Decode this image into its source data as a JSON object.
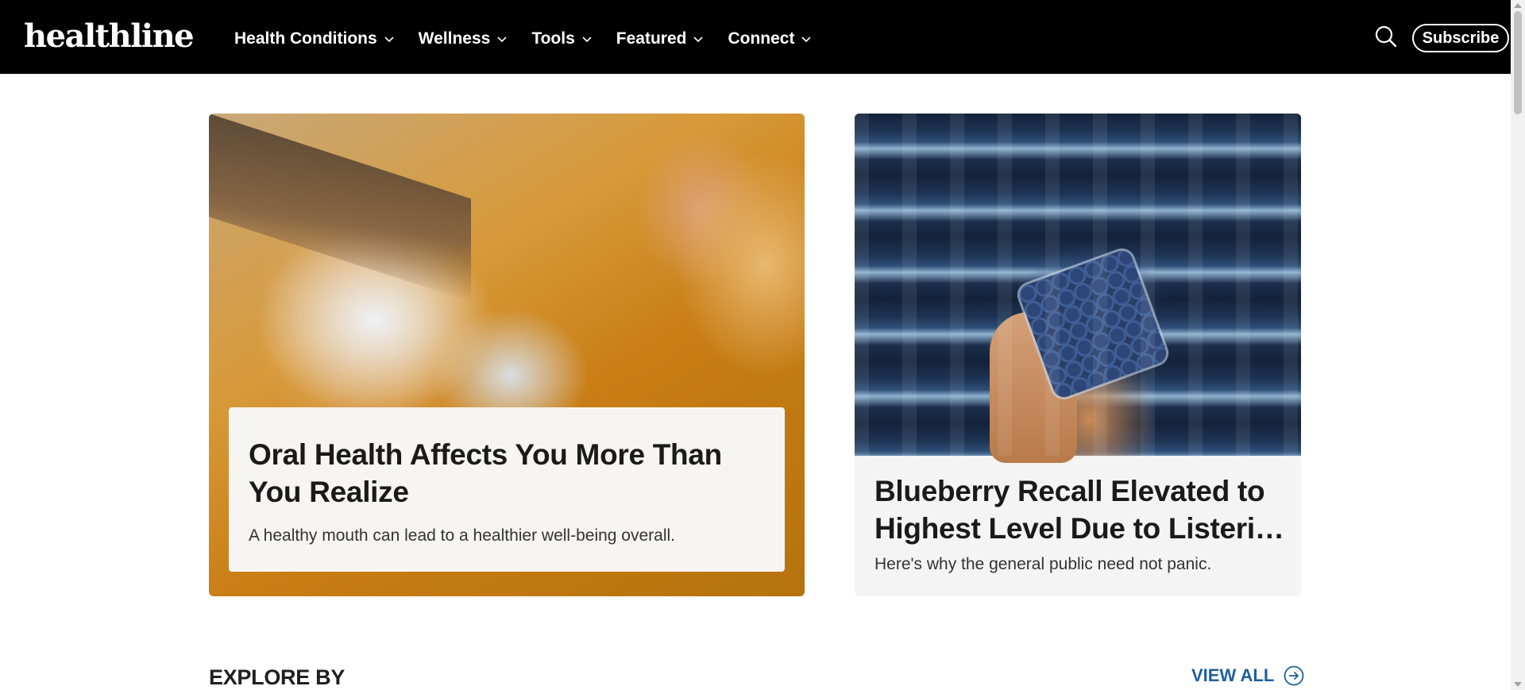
{
  "header": {
    "logo": "healthline",
    "nav": [
      {
        "label": "Health Conditions"
      },
      {
        "label": "Wellness"
      },
      {
        "label": "Tools"
      },
      {
        "label": "Featured"
      },
      {
        "label": "Connect"
      }
    ],
    "subscribe_label": "Subscribe"
  },
  "featured": {
    "left": {
      "title": "Oral Health Affects You More Than You Realize",
      "description": "A healthy mouth can lead to a healthier well-being overall."
    },
    "right": {
      "title": "Blueberry Recall Elevated to Highest Level Due to Listeria Risk",
      "description": "Here's why the general public need not panic."
    }
  },
  "explore": {
    "title": "EXPLORE BY",
    "view_all_label": "VIEW ALL"
  },
  "colors": {
    "nav_bg": "#000000",
    "link_blue": "#1e5f9a",
    "card_bg": "#f4f4f4"
  }
}
